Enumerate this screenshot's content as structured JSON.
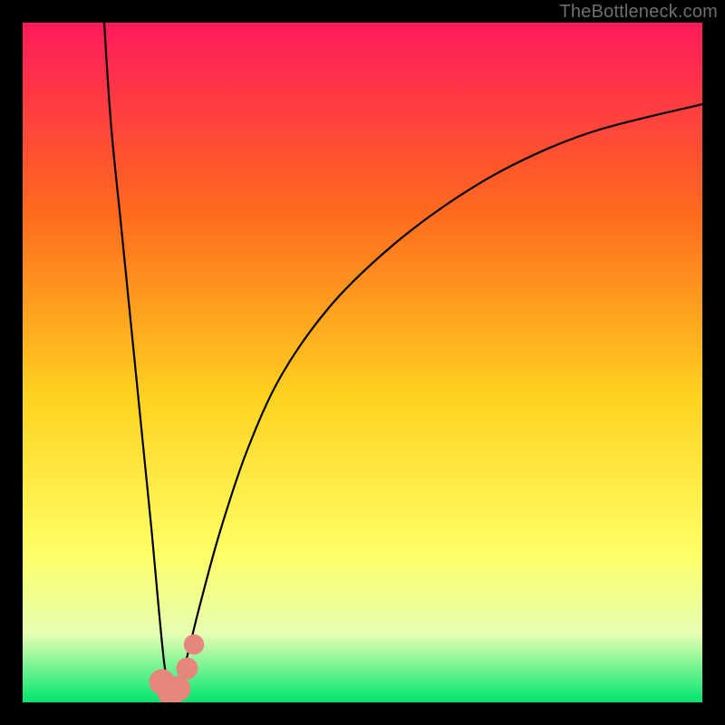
{
  "watermark": "TheBottleneck.com",
  "colors": {
    "grad_top": "#ff1a5b",
    "grad_mid1": "#ff6a1f",
    "grad_mid2": "#ffd21f",
    "grad_mid3": "#ffff66",
    "grad_mid4": "#e6ffb3",
    "grad_bottom": "#00e66e",
    "frame": "#000000",
    "curve": "#000000",
    "marker": "#e6877e"
  },
  "chart_data": {
    "type": "line",
    "title": "",
    "xlabel": "",
    "ylabel": "",
    "xlim": [
      0,
      100
    ],
    "ylim": [
      0,
      100
    ],
    "series": [
      {
        "name": "left-branch",
        "x": [
          12,
          13,
          14.5,
          16,
          17,
          18,
          19,
          20,
          20.8,
          21.5
        ],
        "values": [
          100,
          85,
          70,
          55,
          45,
          35,
          25,
          14,
          6,
          1.5
        ]
      },
      {
        "name": "right-branch",
        "x": [
          22.5,
          24,
          26,
          29,
          33,
          38,
          45,
          53,
          62,
          72,
          84,
          100
        ],
        "values": [
          1.5,
          6,
          14,
          25,
          37,
          48,
          58,
          66,
          73,
          79,
          84,
          88
        ]
      }
    ],
    "markers": [
      {
        "name": "valley-floor-left",
        "x": 20.5,
        "y": 3,
        "r_pct": 1.9
      },
      {
        "name": "valley-floor-mid",
        "x": 21.8,
        "y": 1.5,
        "r_pct": 2.0
      },
      {
        "name": "valley-floor-right",
        "x": 22.8,
        "y": 2,
        "r_pct": 1.9
      },
      {
        "name": "valley-rise-1",
        "x": 24.2,
        "y": 5,
        "r_pct": 1.6
      },
      {
        "name": "valley-rise-2",
        "x": 25.2,
        "y": 8.5,
        "r_pct": 1.5
      }
    ]
  }
}
